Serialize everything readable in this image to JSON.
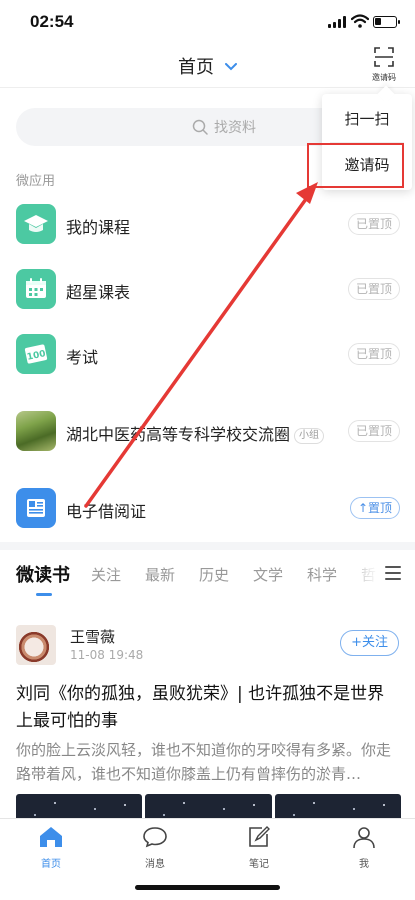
{
  "status_bar": {
    "time": "02:54"
  },
  "header": {
    "title": "首页",
    "invite_label": "邀请码"
  },
  "search": {
    "placeholder": "找资料"
  },
  "section_label": "微应用",
  "apps": [
    {
      "name": "我的课程",
      "pin": "已置顶",
      "icon": "graduation-cap-icon"
    },
    {
      "name": "超星课表",
      "pin": "已置顶",
      "icon": "calendar-icon"
    },
    {
      "name": "考试",
      "pin": "已置顶",
      "icon": "exam-100-icon"
    },
    {
      "name": "湖北中医药高等专科学校交流圈",
      "tag": "小组",
      "pin": "已置顶",
      "icon": "group-photo"
    },
    {
      "name": "电子借阅证",
      "pin": "↑置顶",
      "icon": "library-card-icon"
    }
  ],
  "tabs": [
    "微读书",
    "关注",
    "最新",
    "历史",
    "文学",
    "科学",
    "哲"
  ],
  "post": {
    "author": "王雪薇",
    "time": "11-08 19:48",
    "follow": "+关注",
    "title": "刘同《你的孤独，虽败犹荣》| 也许孤独不是世界上最可怕的事",
    "excerpt": "你的脸上云淡风轻，谁也不知道你的牙咬得有多紧。你走路带着风，谁也不知道你膝盖上仍有曾摔伤的淤青…"
  },
  "popup_menu": {
    "items": [
      "扫一扫",
      "邀请码"
    ]
  },
  "bottom_nav": [
    {
      "label": "首页",
      "icon": "home-icon"
    },
    {
      "label": "消息",
      "icon": "message-icon"
    },
    {
      "label": "笔记",
      "icon": "note-icon"
    },
    {
      "label": "我",
      "icon": "profile-icon"
    }
  ],
  "colors": {
    "accent": "#3d8eea",
    "app_green": "#4cc9a2",
    "annotation_red": "#e53935"
  }
}
